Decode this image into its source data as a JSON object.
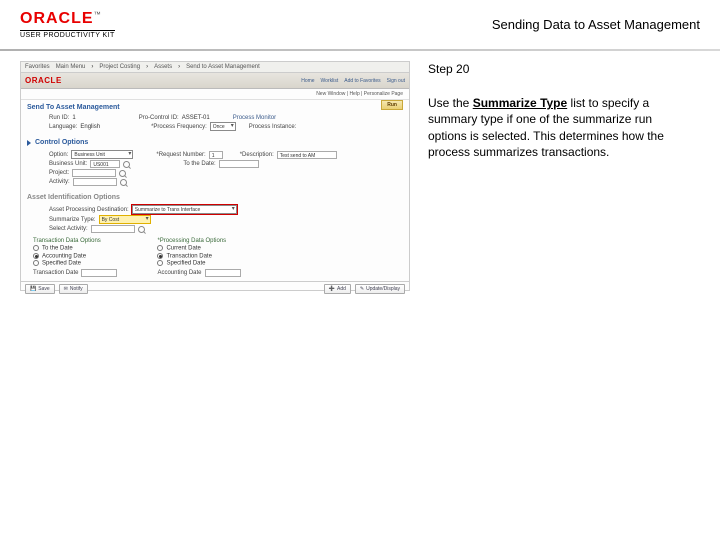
{
  "header": {
    "logo": "ORACLE",
    "tm": "™",
    "upk": "USER PRODUCTIVITY KIT",
    "title": "Sending Data to Asset Management"
  },
  "step": "Step 20",
  "description_prefix": "Use the ",
  "description_bold": "Summarize Type",
  "description_suffix": " list to specify a summary type if one of the summarize run options is selected. This determines how the process summarizes transactions.",
  "app": {
    "menu": [
      "Favorites",
      "Main Menu",
      "Project Costing",
      "Assets",
      "Send to Asset Management"
    ],
    "header_right": [
      "Home",
      "Worklist",
      "Add to Favorites",
      "Sign out"
    ],
    "crumb": "New Window | Help | Personalize Page",
    "page_title": "Send To Asset Management",
    "save": "Run",
    "run_id_lbl": "Run ID:",
    "run_id": "1",
    "pc_lbl": "Pro-Control ID:",
    "pc_val": "ASSET-01",
    "pm_lbl": "Process Monitor",
    "lang_lbl": "Language:",
    "lang_val": "English",
    "pf_lbl": "*Process Frequency:",
    "pf_val": "Once",
    "pi_lbl": "Process Instance:",
    "spec": "Control Options",
    "opt_lbl": "Option:",
    "opt_val": "Business Unit",
    "req_lbl": "*Request Number:",
    "req_val": "1",
    "desc_lbl": "*Description:",
    "desc_val": "Test send to AM",
    "bu_lbl": "Business Unit:",
    "bu_val": "US001",
    "todate_lbl": "To the Date:",
    "proj_lbl": "Project:",
    "act_lbl": "Activity:",
    "amopts": "Asset Identification Options",
    "apg_lbl": "Asset Processing Destination:",
    "apg_val": "Summarize to Trans Interface",
    "st_lbl": "Summarize Type:",
    "st_val": "By Cost",
    "sa_lbl": "Select Activity:",
    "tgl": "Transaction Data Options",
    "pdl": "*Processing Data Options",
    "r1": "To the Date",
    "r2": "Accounting Date",
    "r3": "Specified Date",
    "r4": "Current Date",
    "r5": "Transaction Date",
    "r6": "Specified Date",
    "td_lbl": "Transaction Date",
    "ad_lbl": "Accounting Date",
    "btn_save": "Save",
    "btn_notify": "Notify",
    "btn_add": "Add",
    "btn_upd": "Update/Display"
  }
}
